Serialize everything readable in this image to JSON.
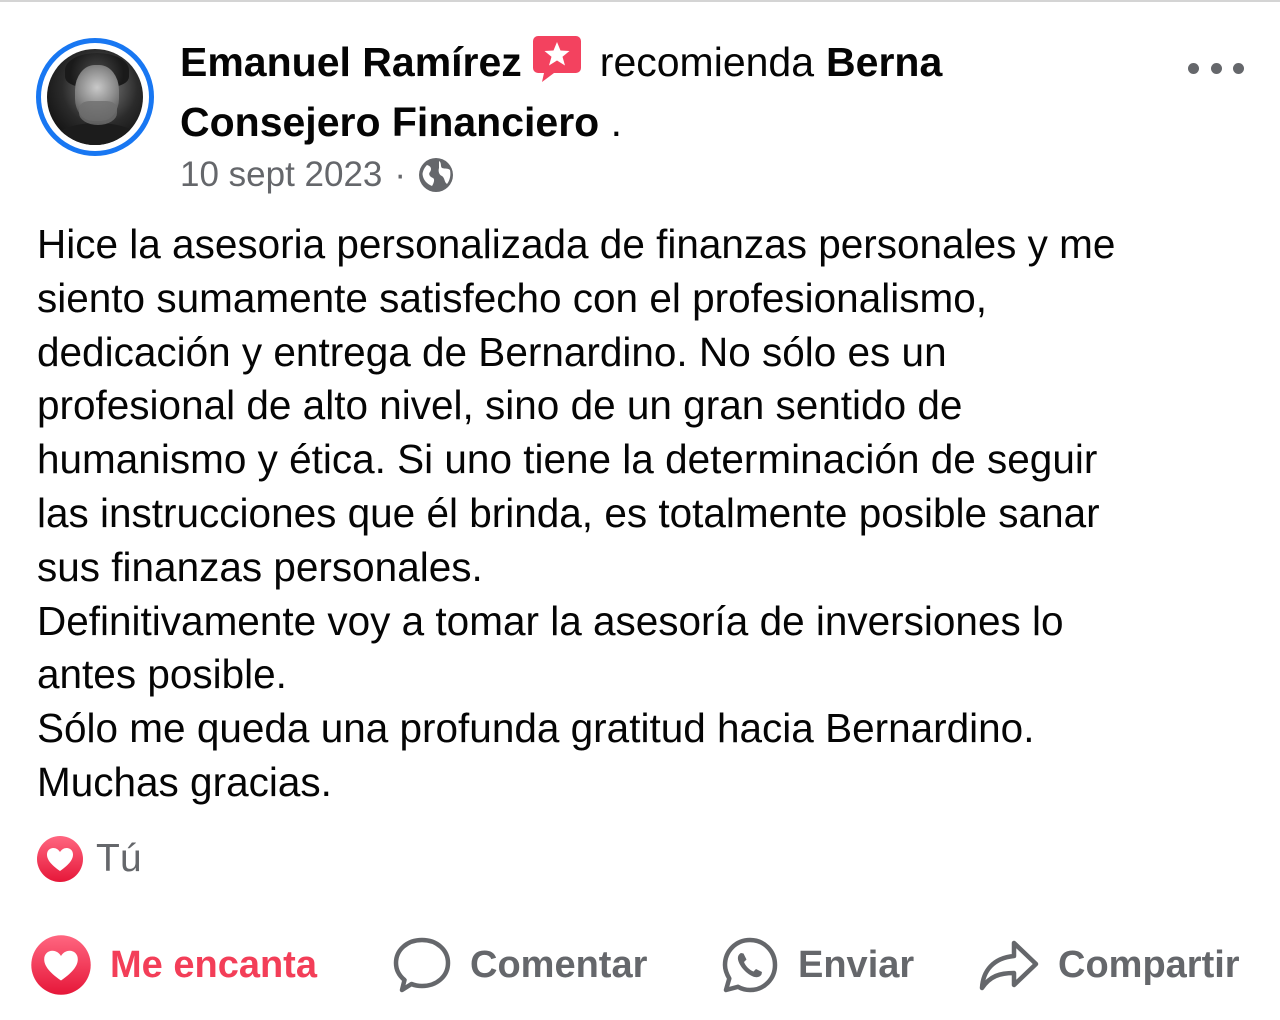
{
  "post": {
    "author": "Emanuel Ramírez",
    "action_text": "recomienda",
    "page_name_line1": "Berna",
    "page_name_line2": "Consejero Financiero",
    "trailing_period": ".",
    "date": "10 sept 2023",
    "separator": "·",
    "privacy_icon": "globe-icon",
    "more_icon": "more-options-icon",
    "body_lines": [
      "Hice la asesoria personalizada de finanzas personales y me",
      "siento sumamente satisfecho con el profesionalismo,",
      "dedicación y entrega de Bernardino. No sólo es un",
      "profesional de alto nivel, sino de un gran sentido de",
      "humanismo y ética. Si uno tiene la determinación de seguir",
      "las instrucciones que él brinda, es totalmente posible sanar",
      "sus finanzas personales.",
      "Definitivamente voy a tomar la asesoría de inversiones lo",
      "antes posible.",
      "Sólo me queda una profunda gratitud hacia Bernardino.",
      "Muchas gracias."
    ]
  },
  "reactions": {
    "icon": "love-reaction-icon",
    "count_label": "Tú"
  },
  "actions": {
    "love_label": "Me encanta",
    "comment_label": "Comentar",
    "send_label": "Enviar",
    "share_label": "Compartir"
  },
  "colors": {
    "accent_blue": "#1877f2",
    "love_red": "#f33e58",
    "secondary_text": "#65676b",
    "recommend_badge": "#f3425f"
  }
}
